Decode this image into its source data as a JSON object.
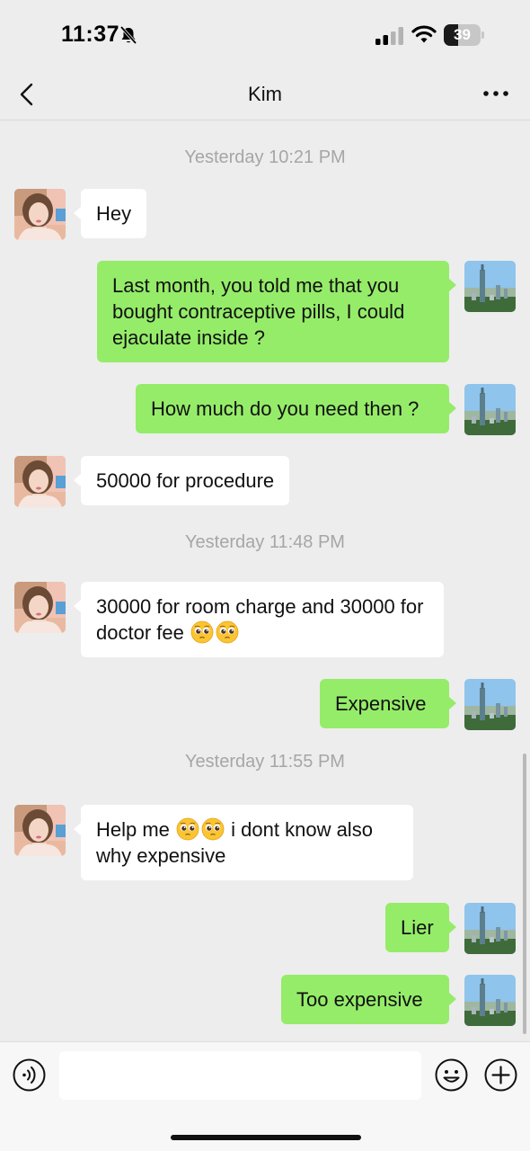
{
  "status_bar": {
    "time": "11:37",
    "battery_level": "39",
    "battery_fraction": 0.39,
    "icons": [
      "bell-slash-icon",
      "cellular-signal-icon",
      "wifi-icon",
      "battery-icon"
    ]
  },
  "nav": {
    "title": "Kim",
    "back_icon": "chevron-left-icon",
    "more_icon": "more-dots-icon"
  },
  "chat": {
    "timestamps": [
      "Yesterday 10:21 PM",
      "Yesterday 11:48 PM",
      "Yesterday 11:55 PM"
    ],
    "messages": [
      {
        "sender": "Kim",
        "direction": "incoming",
        "text": "Hey"
      },
      {
        "sender": "me",
        "direction": "outgoing",
        "text": "Last month, you told me that you bought contraceptive pills, I could ejaculate inside ?"
      },
      {
        "sender": "me",
        "direction": "outgoing",
        "text": "How much do you need then ?"
      },
      {
        "sender": "Kim",
        "direction": "incoming",
        "text": "50000 for procedure"
      },
      {
        "sender": "Kim",
        "direction": "incoming",
        "text": "30000 for room charge and 30000 for doctor fee",
        "emojis": [
          "pleading-face",
          "pleading-face"
        ]
      },
      {
        "sender": "me",
        "direction": "outgoing",
        "text": "Expensive"
      },
      {
        "sender": "Kim",
        "direction": "incoming",
        "text_before": "Help me",
        "emojis": [
          "pleading-face",
          "pleading-face"
        ],
        "text_after": "i dont know also why expensive"
      },
      {
        "sender": "me",
        "direction": "outgoing",
        "text": "Lier"
      },
      {
        "sender": "me",
        "direction": "outgoing",
        "text": "Too expensive"
      }
    ]
  },
  "input_bar": {
    "value": "",
    "placeholder": "",
    "icons": [
      "voice-icon",
      "emoji-face-icon",
      "plus-circle-icon"
    ]
  },
  "colors": {
    "background": "#ededed",
    "incoming_bubble": "#ffffff",
    "outgoing_bubble": "#95ec69",
    "timestamp_text": "#a6a6a6"
  }
}
